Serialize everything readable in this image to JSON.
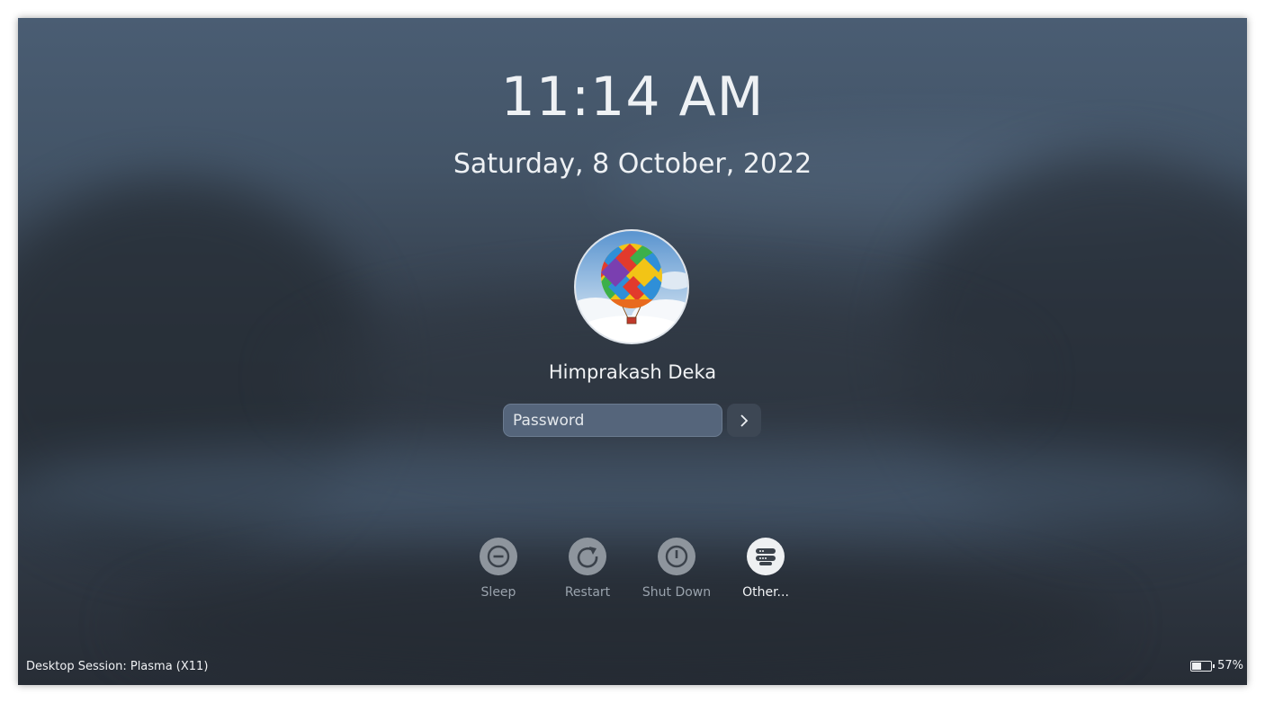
{
  "lockscreen": {
    "time": "11:14 AM",
    "date": "Saturday, 8 October, 2022",
    "user": {
      "name": "Himprakash Deka",
      "avatar_icon": "hot-air-balloon-avatar"
    },
    "password": {
      "placeholder": "Password",
      "value": ""
    },
    "submit_icon": "chevron-right-icon",
    "actions": [
      {
        "label": "Sleep",
        "icon": "sleep-icon"
      },
      {
        "label": "Restart",
        "icon": "restart-icon"
      },
      {
        "label": "Shut Down",
        "icon": "power-icon"
      },
      {
        "label": "Other...",
        "icon": "switch-user-icon"
      }
    ],
    "session_label": "Desktop Session: Plasma (X11)",
    "battery": {
      "percent_text": "57%",
      "level": 0.57
    }
  },
  "colors": {
    "text": "#eef1f4",
    "password_bg": "#55657b",
    "action_circle": "#8e959d",
    "action_active": "#eef0f2"
  }
}
